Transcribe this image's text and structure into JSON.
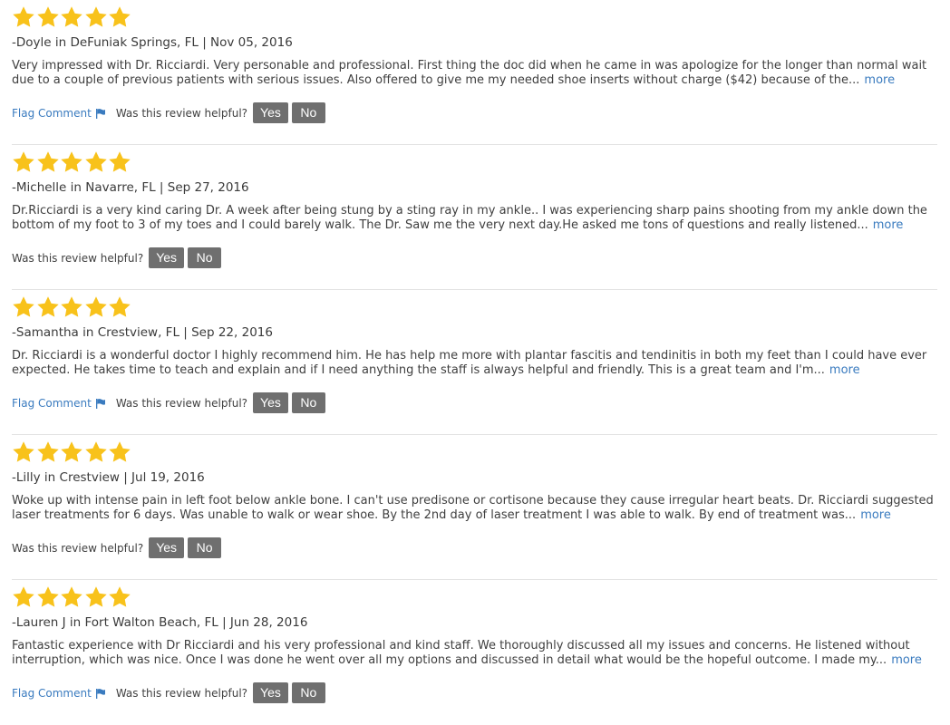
{
  "colors": {
    "star": "#f8c21b",
    "link": "#3a7bbf",
    "button_bg": "#6f6f6f",
    "button_text": "#ffffff",
    "divider": "#e2e2e2"
  },
  "labels": {
    "more": "more",
    "flag_comment": "Flag Comment",
    "helpful_question": "Was this review helpful?",
    "yes": "Yes",
    "no": "No"
  },
  "icons": {
    "star": "star-icon",
    "flag": "flag-icon"
  },
  "reviews": [
    {
      "rating": 5,
      "author": "-Doyle in DeFuniak Springs, FL | Nov 05, 2016",
      "text_lines": [
        "Very impressed with Dr. Ricciardi. Very personable and professional. First thing the doc did when he came in was apologize for the longer than normal wait",
        "due to a couple of previous patients with serious issues. Also offered to give me my needed shoe inserts without charge ($42) because of the..."
      ],
      "show_flag": true
    },
    {
      "rating": 5,
      "author": "-Michelle in Navarre, FL | Sep 27, 2016",
      "text_lines": [
        "Dr.Ricciardi is a very kind caring Dr. A week after being stung by a sting ray in my ankle.. I was experiencing sharp pains shooting from my ankle down the",
        "bottom of my foot to 3 of my toes and I could barely walk. The Dr. Saw me the very next day.He asked me tons of questions and really listened..."
      ],
      "show_flag": false
    },
    {
      "rating": 5,
      "author": "-Samantha in Crestview, FL | Sep 22, 2016",
      "text_lines": [
        "Dr. Ricciardi is a wonderful doctor I highly recommend him. He has help me more with plantar fascitis and tendinitis in both my feet than I could have ever",
        "expected. He takes time to teach and explain and if I need anything the staff is always helpful and friendly. This is a great team and I'm..."
      ],
      "show_flag": true
    },
    {
      "rating": 5,
      "author": "-Lilly in Crestview | Jul 19, 2016",
      "text_lines": [
        "Woke up with intense pain in left foot below ankle bone. I can't use predisone or cortisone because they cause irregular heart beats. Dr. Ricciardi suggested",
        "laser treatments for 6 days. Was unable to walk or wear shoe. By the 2nd day of laser treatment I was able to walk. By end of treatment was..."
      ],
      "show_flag": false
    },
    {
      "rating": 5,
      "author": "-Lauren J in Fort Walton Beach, FL | Jun 28, 2016",
      "text_lines": [
        "Fantastic experience with Dr Ricciardi and his very professional and kind staff. We thoroughly discussed all my issues and concerns. He listened without",
        "interruption, which was nice. Once I was done he went over all my options and discussed in detail what would be the hopeful outcome. I made my..."
      ],
      "show_flag": true
    }
  ]
}
